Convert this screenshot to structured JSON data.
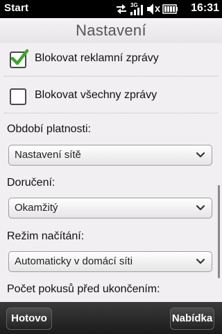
{
  "statusbar": {
    "start_label": "Start",
    "time": "16:31",
    "network_label": "3G",
    "icons": [
      "data-transfer-icon",
      "signal-3g-icon",
      "volume-muted-icon",
      "battery-icon"
    ]
  },
  "header": {
    "title": "Nastavení"
  },
  "checkboxes": [
    {
      "label": "Blokovat reklamní zprávy",
      "checked": true
    },
    {
      "label": "Blokovat všechny zprávy",
      "checked": false
    }
  ],
  "fields": [
    {
      "label": "Období platnosti:",
      "value": "Nastavení sítě"
    },
    {
      "label": "Doručení:",
      "value": "Okamžitý"
    },
    {
      "label": "Režim načítání:",
      "value": "Automaticky v domácí síti"
    },
    {
      "label": "Počet pokusů před ukončením:"
    }
  ],
  "softkeys": {
    "left": "Hotovo",
    "right": "Nabídka"
  },
  "colors": {
    "check_green": "#3fa52a",
    "bottom_bar": "#222222"
  }
}
